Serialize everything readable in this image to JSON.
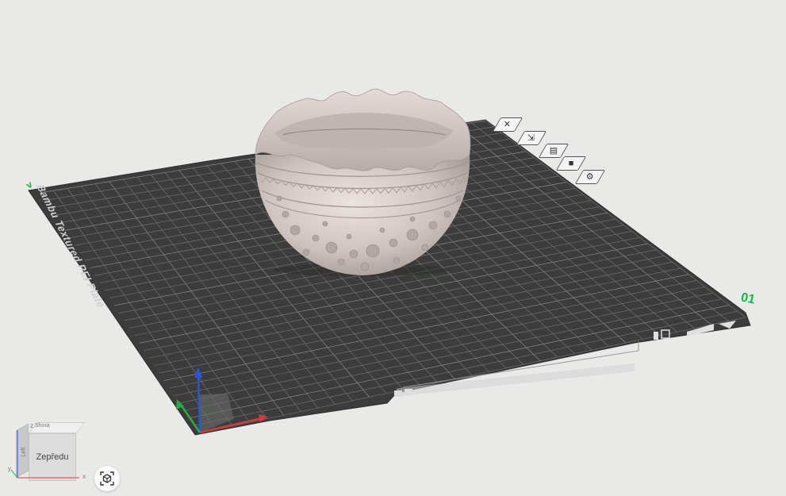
{
  "viewport": {
    "plate_label": "Bambu Textured PEI Plate",
    "plate_number": "01",
    "marker_glyph": "v"
  },
  "plate_toolbar": {
    "buttons": [
      {
        "icon": "close-icon",
        "glyph": "✕"
      },
      {
        "icon": "orient-icon",
        "glyph": "⇲"
      },
      {
        "icon": "arrange-icon",
        "glyph": "▤"
      },
      {
        "icon": "lock-icon",
        "glyph": "■"
      },
      {
        "icon": "settings-icon",
        "glyph": "⚙"
      }
    ]
  },
  "view_cube": {
    "front_label": "Zepředu",
    "top_label": "Shora",
    "left_label": "Left",
    "axes": [
      "z",
      "y",
      "x"
    ]
  },
  "colors": {
    "background": "#e9e9e8",
    "plate": "#3b3c3b",
    "grid": "#6f706f",
    "bowl": "#d2c8c4",
    "plate_number": "#17b24a",
    "axis_x": "#d23b3b",
    "axis_y": "#2fa84a",
    "axis_z": "#2a55d8"
  }
}
